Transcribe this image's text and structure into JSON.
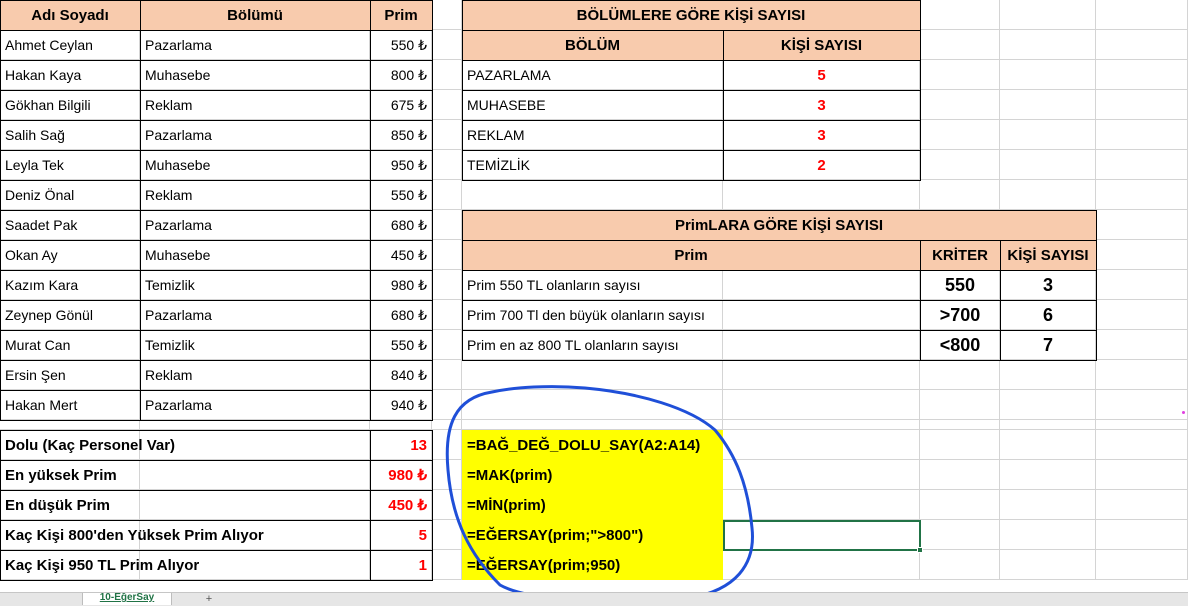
{
  "employees": {
    "headers": {
      "name": "Adı Soyadı",
      "dept": "Bölümü",
      "prim": "Prim"
    },
    "rows": [
      {
        "name": "Ahmet Ceylan",
        "dept": "Pazarlama",
        "prim": "550 ₺"
      },
      {
        "name": "Hakan Kaya",
        "dept": "Muhasebe",
        "prim": "800 ₺"
      },
      {
        "name": "Gökhan Bilgili",
        "dept": "Reklam",
        "prim": "675 ₺"
      },
      {
        "name": "Salih Sağ",
        "dept": "Pazarlama",
        "prim": "850 ₺"
      },
      {
        "name": "Leyla Tek",
        "dept": "Muhasebe",
        "prim": "950 ₺"
      },
      {
        "name": "Deniz Önal",
        "dept": "Reklam",
        "prim": "550 ₺"
      },
      {
        "name": "Saadet Pak",
        "dept": "Pazarlama",
        "prim": "680 ₺"
      },
      {
        "name": "Okan Ay",
        "dept": "Muhasebe",
        "prim": "450 ₺"
      },
      {
        "name": "Kazım Kara",
        "dept": "Temizlik",
        "prim": "980 ₺"
      },
      {
        "name": "Zeynep Gönül",
        "dept": "Pazarlama",
        "prim": "680 ₺"
      },
      {
        "name": "Murat Can",
        "dept": "Temizlik",
        "prim": "550 ₺"
      },
      {
        "name": "Ersin Şen",
        "dept": "Reklam",
        "prim": "840 ₺"
      },
      {
        "name": "Hakan Mert",
        "dept": "Pazarlama",
        "prim": "940 ₺"
      }
    ]
  },
  "summary": {
    "rows": [
      {
        "label": "Dolu (Kaç Personel Var)",
        "value": "13",
        "formula": "=BAĞ_DEĞ_DOLU_SAY(A2:A14)"
      },
      {
        "label": "En yüksek Prim",
        "value": "980 ₺",
        "formula": "=MAK(prim)"
      },
      {
        "label": "En düşük Prim",
        "value": "450 ₺",
        "formula": "=MİN(prim)"
      },
      {
        "label": "Kaç Kişi 800'den Yüksek Prim Alıyor",
        "value": "5",
        "formula": "=EĞERSAY(prim;\">800\")"
      },
      {
        "label": "Kaç Kişi 950 TL Prim Alıyor",
        "value": "1",
        "formula": "=EĞERSAY(prim;950)"
      }
    ]
  },
  "dept_table": {
    "title": "BÖLÜMLERE GÖRE KİŞİ SAYISI",
    "headers": {
      "dept": "BÖLÜM",
      "count": "KİŞİ SAYISI"
    },
    "rows": [
      {
        "dept": "PAZARLAMA",
        "count": "5"
      },
      {
        "dept": "MUHASEBE",
        "count": "3"
      },
      {
        "dept": "REKLAM",
        "count": "3"
      },
      {
        "dept": "TEMİZLİK",
        "count": "2"
      }
    ]
  },
  "prim_table": {
    "title": "PrimLARA GÖRE KİŞİ SAYISI",
    "headers": {
      "prim": "Prim",
      "criteria": "KRİTER",
      "count": "KİŞİ SAYISI"
    },
    "rows": [
      {
        "desc": "Prim 550 TL olanların sayısı",
        "criteria": "550",
        "count": "3"
      },
      {
        "desc": "Prim 700 Tl den büyük olanların sayısı",
        "criteria": ">700",
        "count": "6"
      },
      {
        "desc": "Prim en az 800 TL olanların sayısı",
        "criteria": "<800",
        "count": "7"
      }
    ]
  },
  "sheet_tabs": {
    "active": "10-EğerSay",
    "add_icon": "+"
  },
  "colors": {
    "header_fill": "#f8cbad",
    "highlight_fill": "#ffff00",
    "value_red": "#ff0000",
    "selection_green": "#217346",
    "annotation_blue": "#1f4fd8"
  },
  "annotation": {
    "shape": "hand-drawn ellipse",
    "color": "blue"
  }
}
